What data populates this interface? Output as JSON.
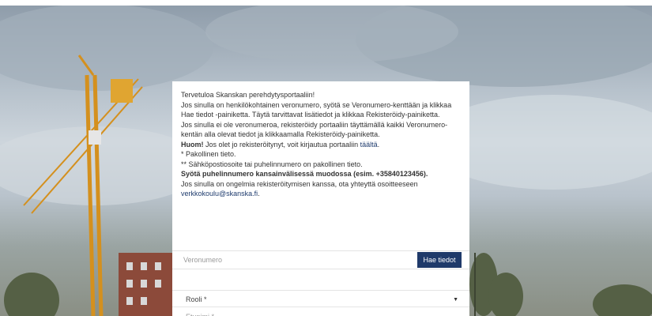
{
  "intro": {
    "welcome": "Tervetuloa Skanskan perehdytysportaaliin!",
    "para_tax_number": "Jos sinulla on henkilökohtainen veronumero, syötä se Veronumero-kenttään ja klikkaa Hae tiedot -painiketta. Täytä tarvittavat lisätiedot ja klikkaa Rekisteröidy-painiketta.",
    "para_no_tax_number": "Jos sinulla ei ole veronumeroa, rekisteröidy portaaliin täyttämällä kaikki Veronumero-kentän alla olevat tiedot ja klikkaamalla Rekisteröidy-painiketta.",
    "notice_bold": "Huom!",
    "notice_text": " Jos olet jo rekisteröitynyt, voit kirjautua portaaliin ",
    "notice_link": "täältä",
    "notice_end": ".",
    "required_note": "* Pakollinen tieto.",
    "contact_required_note": "** Sähköpostiosoite tai puhelinnumero on pakollinen tieto.",
    "phone_format_note": "Syötä puhelinnumero kansainvälisessä muodossa (esim. +35840123456).",
    "help_text": "Jos sinulla on ongelmia rekisteröitymisen kanssa, ota yhteyttä osoitteeseen",
    "help_email": "verkkokoulu@skanska.fi",
    "help_end": "."
  },
  "form": {
    "tax_number_placeholder": "Veronumero",
    "fetch_button_label": "Hae tiedot",
    "role_label": "Rooli *",
    "first_name_placeholder": "Etunimi *"
  },
  "colors": {
    "button_bg": "#1f3a6a",
    "link": "#1f3c6e"
  },
  "icons": {
    "role_dropdown": "caret-down-icon"
  }
}
